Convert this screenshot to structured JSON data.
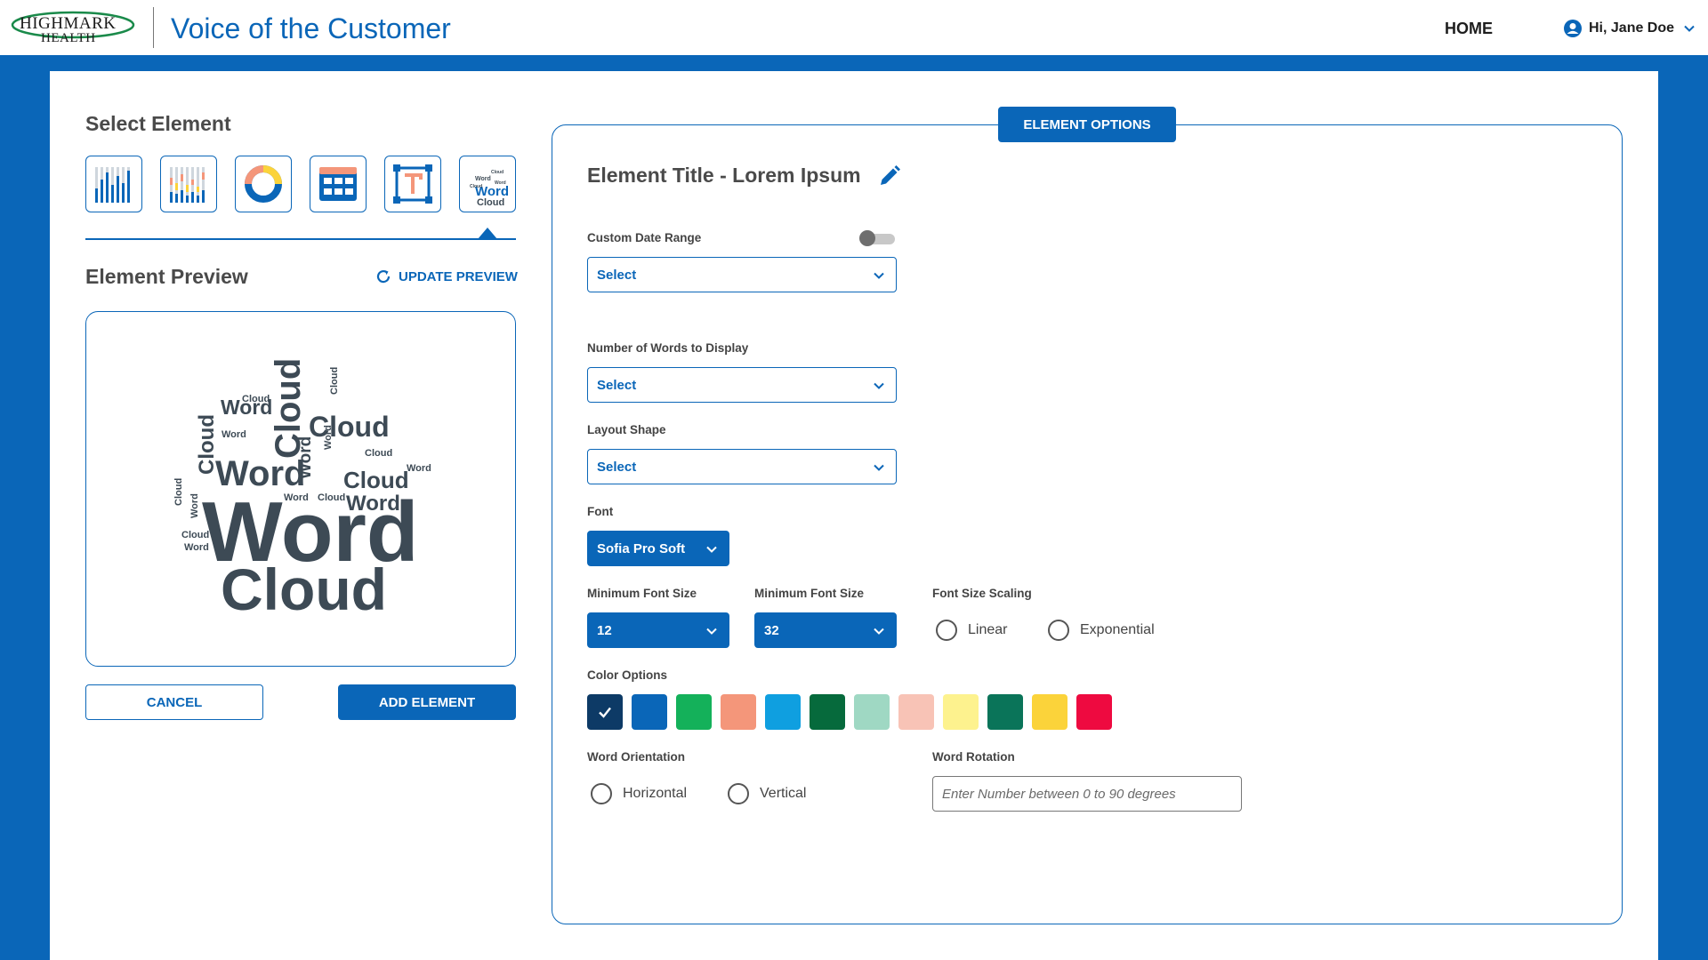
{
  "header": {
    "logo_line1": "HIGHMARK",
    "logo_line2": "HEALTH",
    "app_title": "Voice of the Customer",
    "home_label": "HOME",
    "user_greeting": "Hi, Jane Doe"
  },
  "left": {
    "select_title": "Select Element",
    "element_types": [
      "bar-chart-icon",
      "stacked-bar-chart-icon",
      "donut-chart-icon",
      "table-icon",
      "text-box-icon",
      "word-cloud-icon"
    ],
    "selected_element": "word-cloud-icon",
    "preview_title": "Element Preview",
    "update_preview_label": "UPDATE PREVIEW",
    "cancel_label": "CANCEL",
    "add_label": "ADD ELEMENT"
  },
  "word_cloud_preview": [
    "Word",
    "Cloud"
  ],
  "options": {
    "tab_label": "ELEMENT OPTIONS",
    "element_title": "Element Title - Lorem Ipsum",
    "custom_date_range_label": "Custom Date Range",
    "custom_date_range_on": false,
    "custom_date_range_value": "Select",
    "num_words_label": "Number of Words to Display",
    "num_words_value": "Select",
    "layout_shape_label": "Layout Shape",
    "layout_shape_value": "Select",
    "font_label": "Font",
    "font_value": "Sofia Pro Soft",
    "min_font_label": "Minimum Font Size",
    "min_font_value": "12",
    "max_font_label": "Minimum Font Size",
    "max_font_value": "32",
    "scaling_label": "Font Size Scaling",
    "scaling_options": [
      "Linear",
      "Exponential"
    ],
    "color_label": "Color Options",
    "colors": [
      "#0d3a66",
      "#0a66b8",
      "#14b15a",
      "#f4967a",
      "#0f9fe0",
      "#066a3c",
      "#9fd8c3",
      "#f8c3b6",
      "#fdf28e",
      "#0a7459",
      "#fbd33a",
      "#ee0a40"
    ],
    "selected_color_index": 0,
    "orientation_label": "Word Orientation",
    "orientation_options": [
      "Horizontal",
      "Vertical"
    ],
    "rotation_label": "Word Rotation",
    "rotation_placeholder": "Enter Number between 0 to 90 degrees"
  }
}
